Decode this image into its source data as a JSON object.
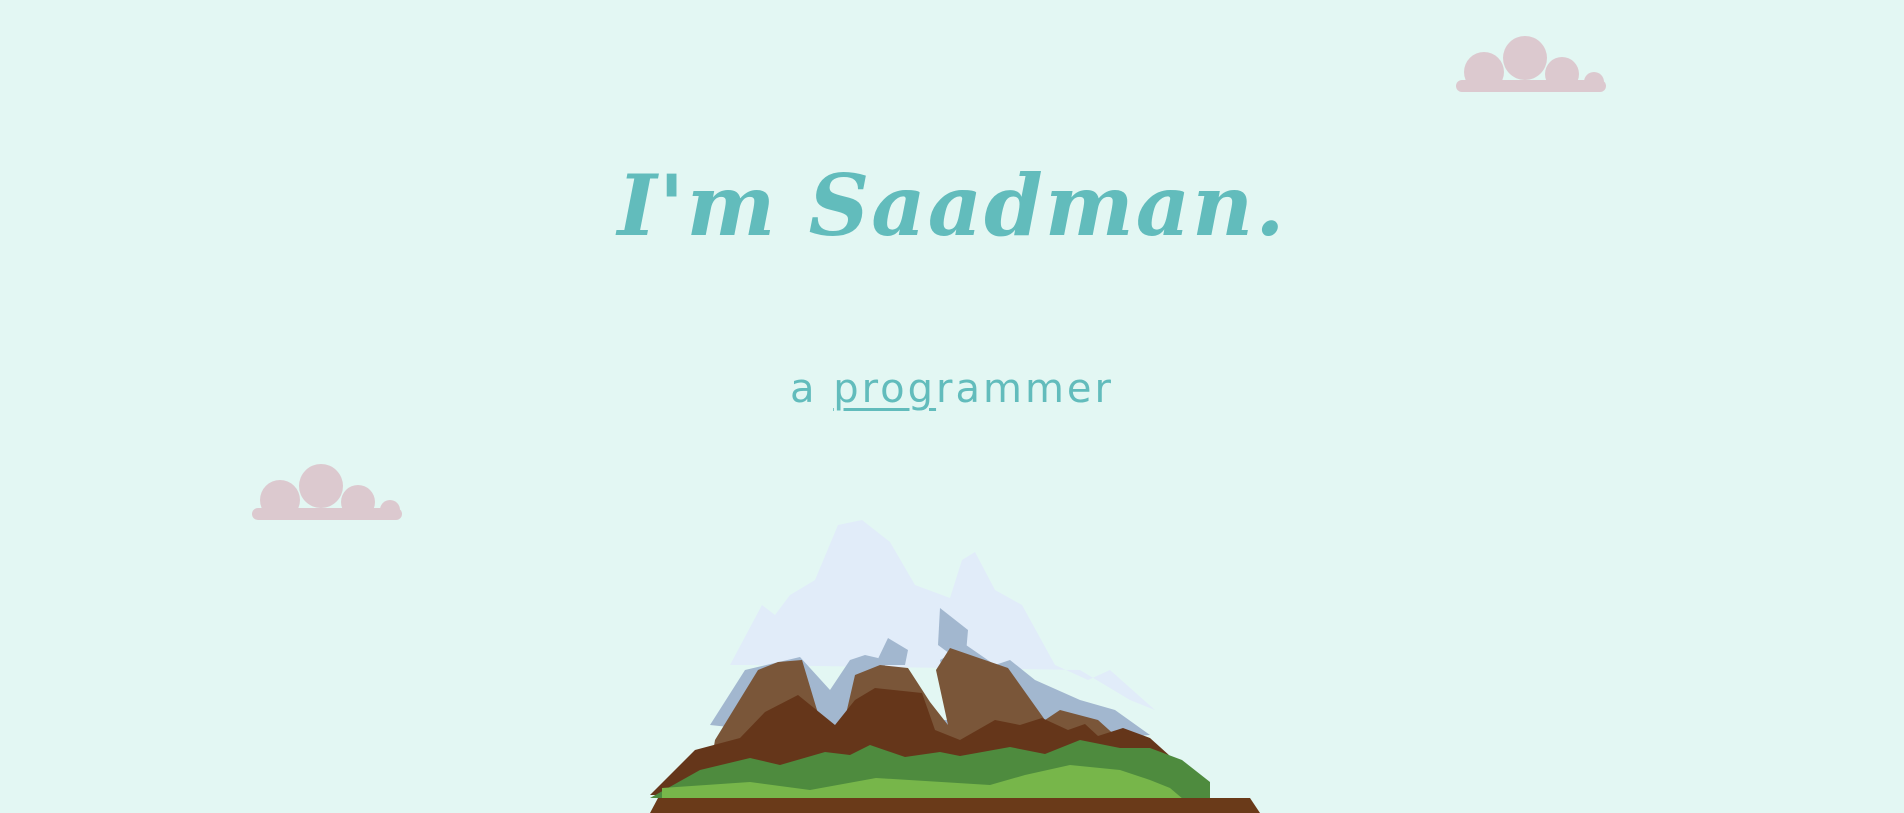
{
  "hero": {
    "title": "I'm Saadman.",
    "subtitle_prefix": "a ",
    "subtitle_typed": "prog",
    "subtitle_rest": "rammer"
  },
  "colors": {
    "background": "#e3f7f3",
    "accent": "#62bcbc",
    "cloud": "#dcc9cf"
  }
}
